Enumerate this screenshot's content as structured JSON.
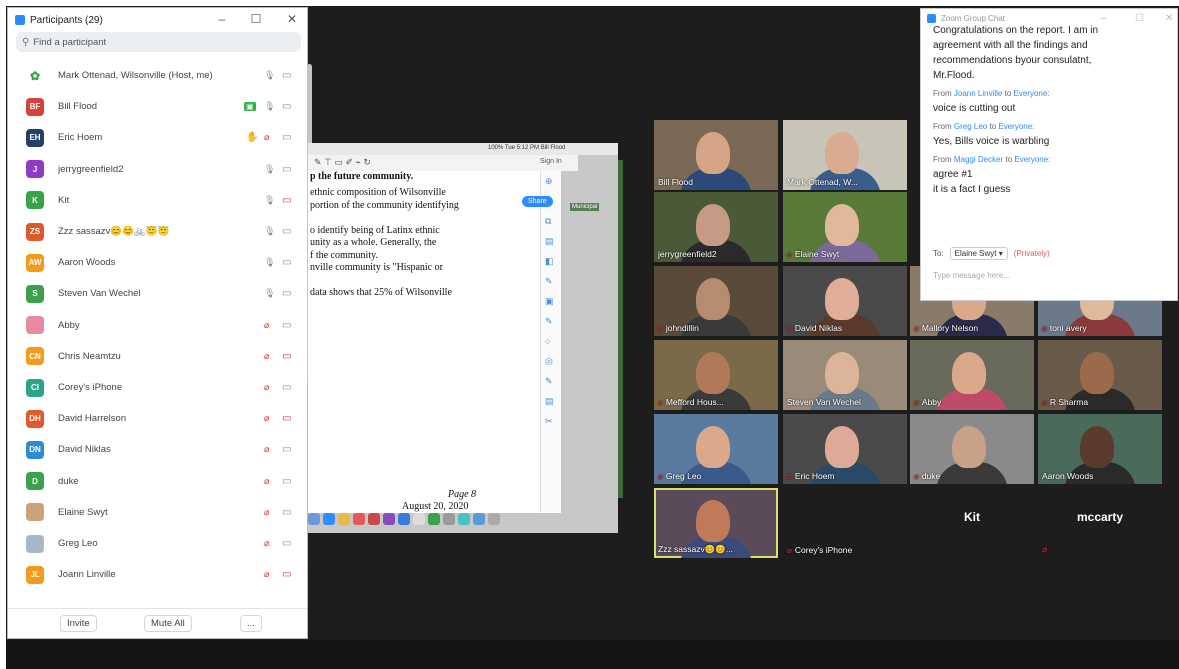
{
  "participants_panel": {
    "title": "Participants (29)",
    "search_placeholder": "Find a participant",
    "participants": [
      {
        "initials": "",
        "name": "Mark Ottenad, Wilsonville (Host, me)",
        "color": "#ffffff",
        "mic": "on",
        "video": "off"
      },
      {
        "initials": "BF",
        "name": "Bill Flood",
        "color": "#d9413b",
        "mic": "on",
        "video": "off",
        "screen_share": true
      },
      {
        "initials": "EH",
        "name": "Eric Hoem",
        "color": "#23406a",
        "mic": "muted",
        "video": "off",
        "hand_raised": true
      },
      {
        "initials": "J",
        "name": "jerrygreenfield2",
        "color": "#8e3ac2",
        "mic": "on",
        "video": "off"
      },
      {
        "initials": "K",
        "name": "Kit",
        "color": "#3aa24a",
        "mic": "on",
        "video": "stopped"
      },
      {
        "initials": "ZS",
        "name": "Zzz sassazv😊😊🚲😇😇",
        "color": "#d95a2b",
        "mic": "on",
        "video": "off"
      },
      {
        "initials": "AW",
        "name": "Aaron Woods",
        "color": "#f29b1d",
        "mic": "on",
        "video": "off"
      },
      {
        "initials": "S",
        "name": "Steven Van Wechel",
        "color": "#3aa24a",
        "mic": "on",
        "video": "off"
      },
      {
        "initials": "",
        "name": "Abby",
        "color": "#e58aa0",
        "mic": "muted",
        "video": "off"
      },
      {
        "initials": "CN",
        "name": "Chris Neamtzu",
        "color": "#f29b1d",
        "mic": "muted",
        "video": "stopped"
      },
      {
        "initials": "CI",
        "name": "Corey's iPhone",
        "color": "#2aa58a",
        "mic": "muted",
        "video": "off"
      },
      {
        "initials": "DH",
        "name": "David Harrelson",
        "color": "#e05a2b",
        "mic": "muted",
        "video": "stopped"
      },
      {
        "initials": "DN",
        "name": "David Niklas",
        "color": "#2d8cd8",
        "mic": "muted",
        "video": "off"
      },
      {
        "initials": "D",
        "name": "duke",
        "color": "#3aa24a",
        "mic": "muted",
        "video": "off"
      },
      {
        "initials": "",
        "name": "Elaine Swyt",
        "color": "#c9a37c",
        "mic": "muted",
        "video": "off"
      },
      {
        "initials": "",
        "name": "Greg Leo",
        "color": "#a8b7c8",
        "mic": "muted",
        "video": "off"
      },
      {
        "initials": "JL",
        "name": "Joann Linville",
        "color": "#f29b1d",
        "mic": "muted",
        "video": "stopped"
      }
    ],
    "invite_label": "Invite",
    "mute_all_label": "Mute All",
    "more_label": "..."
  },
  "document": {
    "heading_partial": "p the future community.",
    "lines": [
      "ethnic composition of Wilsonville",
      "portion of the community identifying",
      "",
      "o identify being of Latinx ethnic",
      "unity as a whole. Generally, the",
      "f the community.",
      "nville community is \"Hispanic or",
      "",
      "data shows that 25% of Wilsonville"
    ],
    "page_label": "Page 8",
    "date_label": "August 20, 2020",
    "share_label": "Share",
    "sign_in_label": "Sign In",
    "menubar_text": "100% Tue 5:12 PM  Bill Flood",
    "badge_text": "Municipal"
  },
  "video_grid": [
    {
      "name": "Bill Flood",
      "muted": false,
      "bg": "#7a6a55",
      "face": "#d6a487",
      "shirt": "#2b4a7a"
    },
    {
      "name": "Mark Ottenad, W...",
      "muted": false,
      "bg": "#c9c4b8",
      "face": "#d9ab90",
      "shirt": "#3b5d8c"
    },
    {
      "name": "jerrygreenfield2",
      "muted": false,
      "bg": "#4a5a38",
      "face": "#c79a86",
      "shirt": "#2a2a2a"
    },
    {
      "name": "Elaine Swyt",
      "muted": true,
      "bg": "#5a7a3a",
      "face": "#e1b99a",
      "shirt": "#7a6a9a"
    },
    {
      "name": "johndillin",
      "muted": true,
      "bg": "#5a4a3a",
      "face": "#b68c6e",
      "shirt": "#3a3a3a"
    },
    {
      "name": "David Niklas",
      "muted": true,
      "bg": "#4a4a4a",
      "face": "#e0ad96",
      "shirt": "#5a3a2a"
    },
    {
      "name": "Mallory Nelson",
      "muted": true,
      "bg": "#8a7a6a",
      "face": "#d9a98a",
      "shirt": "#2a2a4a"
    },
    {
      "name": "toni avery",
      "muted": true,
      "bg": "#6a7a8a",
      "face": "#e0b89a",
      "shirt": "#8a3a3a"
    },
    {
      "name": "Mefford Hous...",
      "muted": true,
      "bg": "#7a6a4a",
      "face": "#b07a5a",
      "shirt": "#3a3a3a"
    },
    {
      "name": "Steven Van Wechel",
      "muted": false,
      "bg": "#9a8a7a",
      "face": "#dcb49c",
      "shirt": "#6a7a8a"
    },
    {
      "name": "Abby",
      "muted": true,
      "bg": "#6a6a5a",
      "face": "#d9a98a",
      "shirt": "#c04a6a"
    },
    {
      "name": "R Sharma",
      "muted": true,
      "bg": "#6a5a4a",
      "face": "#9a6a4a",
      "shirt": "#2a2a2a"
    },
    {
      "name": "Greg Leo",
      "muted": true,
      "bg": "#5a7aa0",
      "face": "#d9a98a",
      "shirt": "#3a5a8a"
    },
    {
      "name": "Eric Hoem",
      "muted": true,
      "bg": "#4a4a4a",
      "face": "#dcaa96",
      "shirt": "#2a4a6a"
    },
    {
      "name": "duke",
      "muted": true,
      "bg": "#8a8a8a",
      "face": "#c9a088",
      "shirt": "#3a3a3a"
    },
    {
      "name": "Aaron Woods",
      "muted": false,
      "bg": "#4a6a5a",
      "face": "#5a3a2a",
      "shirt": "#2a2a2a"
    },
    {
      "name": "Zzz sassazv😊😊...",
      "muted": false,
      "bg": "#5a4a5a",
      "face": "#c07a5a",
      "shirt": "#3a4a7a",
      "active": true
    },
    {
      "name": "Corey's iPhone",
      "muted": true,
      "bg": "#1d1d1d",
      "blank": true
    },
    {
      "name": "Kit",
      "muted": false,
      "bg": "#1d1d1d",
      "blank": true,
      "big": true
    },
    {
      "name": "mccarty",
      "muted": true,
      "bg": "#1d1d1d",
      "blank": true,
      "big": true
    }
  ],
  "chat": {
    "title": "Zoom Group Chat",
    "messages": [
      {
        "text": "Congratulations on the report. I am in"
      },
      {
        "text": "agreement with all the findings and"
      },
      {
        "text": "recommendations byour consulatnt,"
      },
      {
        "text": "Mr.Flood."
      },
      {
        "from": "From",
        "user": "Joann Linville",
        "to": "to",
        "target": "Everyone:",
        "text": "voice is cutting out"
      },
      {
        "from": "From",
        "user": "Greg Leo",
        "to": "to",
        "target": "Everyone:",
        "text": "Yes, Bills voice is warbling"
      },
      {
        "from": "From",
        "user": "Maggi Decker",
        "to": "to",
        "target": "Everyone:",
        "text": "agree #1"
      },
      {
        "text": "it is a fact I guess"
      }
    ],
    "to_label": "To:",
    "recipient": "Elaine Swyt ▾",
    "privately_label": "(Privately)",
    "input_placeholder": "Type message here..."
  }
}
